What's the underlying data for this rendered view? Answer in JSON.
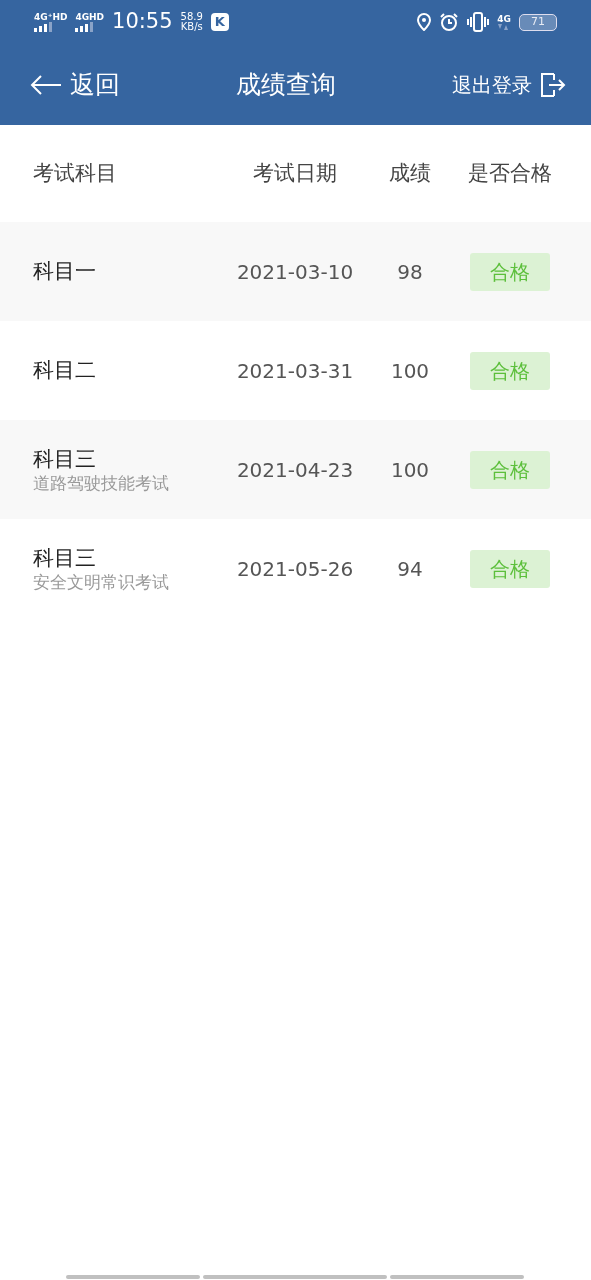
{
  "status_bar": {
    "sim_1": "4G⁺HD",
    "sim_2": "4GHD",
    "time": "10:55",
    "speed_value": "58.9",
    "speed_unit": "KB/s",
    "app_badge": "K",
    "network": "4G",
    "battery": "71"
  },
  "header": {
    "back": "返回",
    "title": "成绩查询",
    "logout": "退出登录"
  },
  "table": {
    "columns": [
      "考试科目",
      "考试日期",
      "成绩",
      "是否合格"
    ],
    "rows": [
      {
        "subject": "科目一",
        "date": "2021-03-10",
        "score": "98",
        "result": "合格",
        "passed": true
      },
      {
        "subject": "科目二",
        "date": "2021-03-31",
        "score": "100",
        "result": "合格",
        "passed": true
      },
      {
        "subject": "科目三",
        "detail": "道路驾驶技能考试",
        "date": "2021-04-23",
        "score": "100",
        "result": "合格",
        "passed": true
      },
      {
        "subject": "科目三",
        "detail": "安全文明常识考试",
        "date": "2021-05-26",
        "score": "94",
        "result": "合格",
        "passed": true
      }
    ]
  }
}
